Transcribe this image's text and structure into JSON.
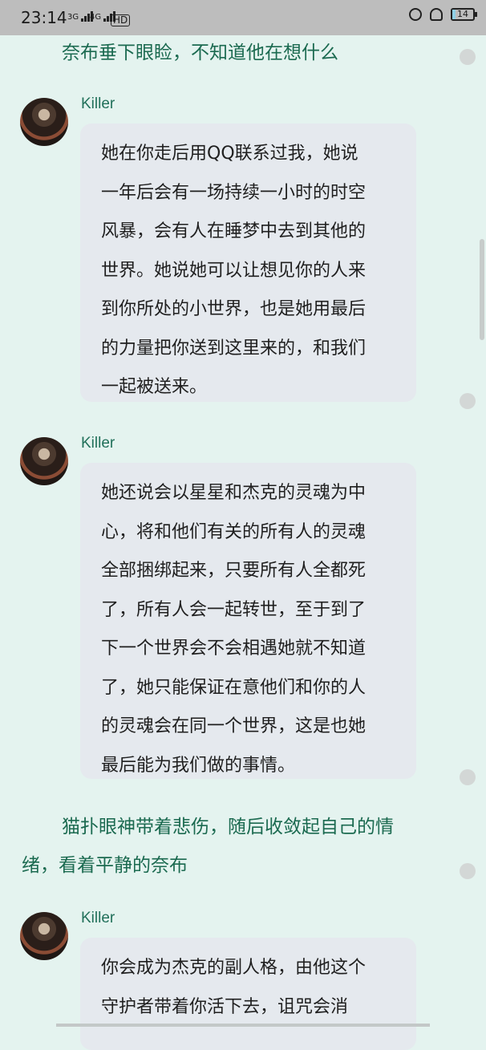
{
  "status_bar": {
    "time": "23:14",
    "signal_1": "3G",
    "signal_2": "4G",
    "hd": "HD",
    "battery": "14"
  },
  "narration": [
    "奈布垂下眼睑，不知道他在想什么",
    "猫扑眼神带着悲伤，随后收敛起自己的情",
    "绪，看着平静的奈布"
  ],
  "messages": [
    {
      "sender": "Killer",
      "lines": [
        "她在你走后用QQ联系过我，她说",
        "一年后会有一场持续一小时的时空",
        "风暴，会有人在睡梦中去到其他的",
        "世界。她说她可以让想见你的人来",
        "到你所处的小世界，也是她用最后",
        "的力量把你送到这里来的，和我们",
        "一起被送来。"
      ]
    },
    {
      "sender": "Killer",
      "lines": [
        "她还说会以星星和杰克的灵魂为中",
        "心，将和他们有关的所有人的灵魂",
        "全部捆绑起来，只要所有人全都死",
        "了，所有人会一起转世，至于到了",
        "下一个世界会不会相遇她就不知道",
        "了，她只能保证在意他们和你的人",
        "的灵魂会在同一个世界，这是也她",
        "最后能为我们做的事情。"
      ]
    },
    {
      "sender": "Killer",
      "lines": [
        "你会成为杰克的副人格，由他这个",
        "守护者带着你活下去，诅咒会消"
      ]
    }
  ]
}
